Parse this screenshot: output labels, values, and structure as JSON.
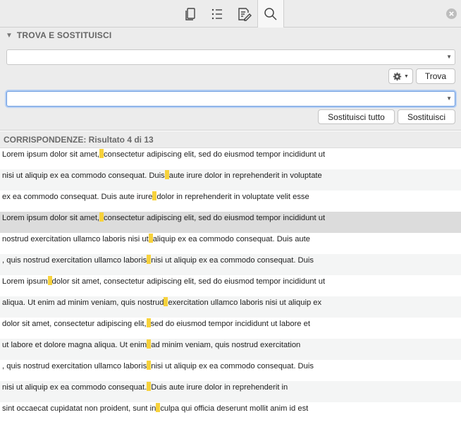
{
  "toolbar": {
    "icons": [
      "pages-icon",
      "list-icon",
      "edit-notes-icon",
      "search-icon"
    ],
    "active": "search-icon"
  },
  "panel": {
    "title": "TROVA E SOSTITUISCI"
  },
  "find": {
    "value": "",
    "button_label": "Trova"
  },
  "replace": {
    "value": "",
    "replace_all_label": "Sostituisci tutto",
    "replace_label": "Sostituisci"
  },
  "results": {
    "header": "CORRISPONDENZE: Risultato 4 di 13",
    "selected_index": 3,
    "rows": [
      {
        "before": "Lorem ipsum dolor sit amet,",
        "after": "consectetur adipiscing elit, sed do eiusmod tempor incididunt ut"
      },
      {
        "before": "nisi ut aliquip ex ea commodo consequat. Duis",
        "after": "aute irure  dolor in reprehenderit in voluptate"
      },
      {
        "before": "ex ea commodo consequat. Duis  aute irure",
        "after": "dolor in reprehenderit in voluptate velit esse"
      },
      {
        "before": "Lorem ipsum dolor sit amet,",
        "after": "consectetur adipiscing elit, sed do eiusmod tempor incididunt ut"
      },
      {
        "before": "nostrud exercitation ullamco laboris nisi ut",
        "after": "aliquip ex ea commodo consequat. Duis aute"
      },
      {
        "before": ", quis nostrud exercitation ullamco laboris",
        "after": "nisi ut aliquip ex ea commodo consequat. Duis"
      },
      {
        "before": "Lorem ipsum",
        "after": "dolor sit amet, consectetur adipiscing elit, sed do eiusmod tempor incididunt ut"
      },
      {
        "before": "aliqua. Ut enim ad minim veniam, quis nostrud",
        "after": "exercitation ullamco laboris nisi ut aliquip ex"
      },
      {
        "before": "dolor sit amet, consectetur adipiscing elit,",
        "after": "sed do eiusmod tempor incididunt ut labore et"
      },
      {
        "before": "ut labore et dolore magna aliqua. Ut enim",
        "after": "ad minim veniam, quis nostrud exercitation"
      },
      {
        "before": ", quis nostrud exercitation ullamco laboris",
        "after": "nisi ut aliquip ex ea commodo consequat.  Duis"
      },
      {
        "before": "nisi ut aliquip ex ea commodo consequat.",
        "after": "Duis aute irure dolor in reprehenderit in"
      },
      {
        "before": "sint occaecat cupidatat non proident, sunt in",
        "after": "culpa qui officia deserunt mollit anim id est"
      }
    ]
  },
  "colors": {
    "highlight": "#f7d23c",
    "focus": "#6a9be0"
  }
}
